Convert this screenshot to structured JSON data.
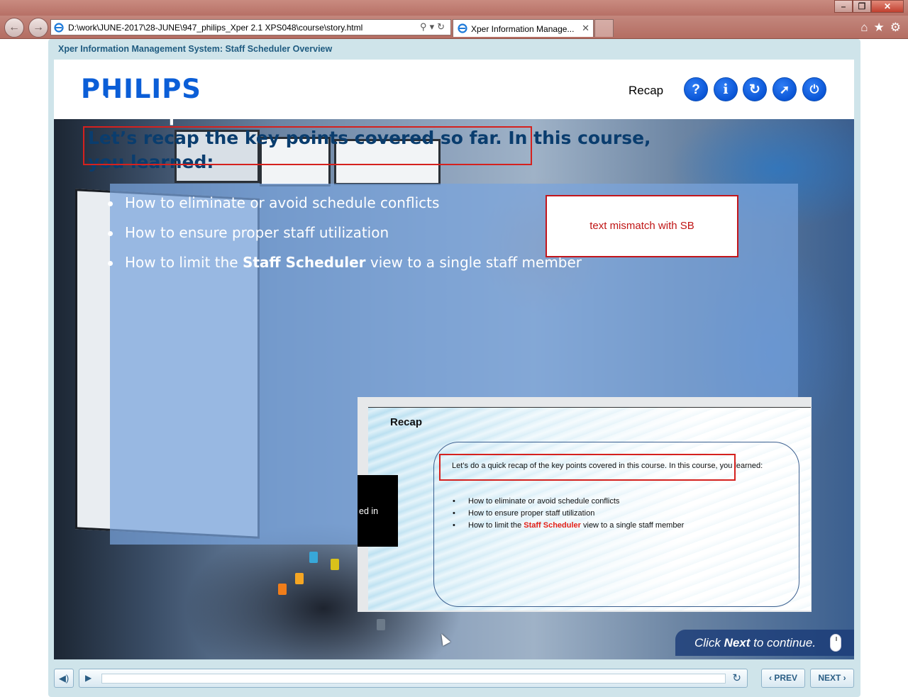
{
  "browser": {
    "url": "D:\\work\\JUNE-2017\\28-JUNE\\947_philips_Xper 2.1 XPS048\\course\\story.html",
    "tab_title": "Xper Information Manage...",
    "back_icon": "back-arrow-icon",
    "forward_icon": "forward-arrow-icon",
    "toolbar_icons": [
      "home-icon",
      "favorites-star-icon",
      "settings-gear-icon"
    ]
  },
  "course": {
    "title": "Xper Information Management System: Staff Scheduler Overview",
    "logo": "PHILIPS",
    "section_label": "Recap",
    "header_buttons": [
      {
        "name": "help-icon",
        "glyph": "?"
      },
      {
        "name": "info-icon",
        "glyph": "i"
      },
      {
        "name": "refresh-icon",
        "glyph": "↻"
      },
      {
        "name": "compass-icon",
        "glyph": "⟋"
      },
      {
        "name": "power-icon",
        "glyph": "⏻"
      }
    ]
  },
  "slide": {
    "title": "Recap",
    "intro": "Let’s recap the key points covered so far. In this course, you learned:",
    "bullets": [
      {
        "text_before": "How to eliminate or avoid schedule conflicts",
        "bold": "",
        "text_after": ""
      },
      {
        "text_before": "How to ensure proper staff utilization",
        "bold": "",
        "text_after": ""
      },
      {
        "text_before": "How to limit the ",
        "bold": "Staff Scheduler",
        "text_after": " view to a single staff member"
      }
    ],
    "review_note": "text mismatch with SB",
    "black_box_text": "ed in",
    "cta": {
      "before": "Click ",
      "bold": "Next",
      "after": " to continue."
    }
  },
  "storyboard": {
    "title": "Recap",
    "intro": "Let’s do a quick recap of the key points covered in this course. In this course, you learned:",
    "bullets": [
      {
        "text_before": "How to eliminate or avoid schedule conflicts",
        "red": "",
        "text_after": ""
      },
      {
        "text_before": "How to ensure proper staff utilization",
        "red": "",
        "text_after": ""
      },
      {
        "text_before": "How to limit the ",
        "red": "Staff Scheduler",
        "text_after": " view to a single staff member"
      }
    ]
  },
  "controls": {
    "prev_label": "PREV",
    "next_label": "NEXT",
    "volume_icon": "speaker-icon",
    "play_icon": "play-icon",
    "replay_icon": "replay-icon"
  },
  "colors": {
    "philips_blue": "#0b5ed7",
    "review_red": "#d5211e",
    "course_title": "#1f5b80"
  }
}
